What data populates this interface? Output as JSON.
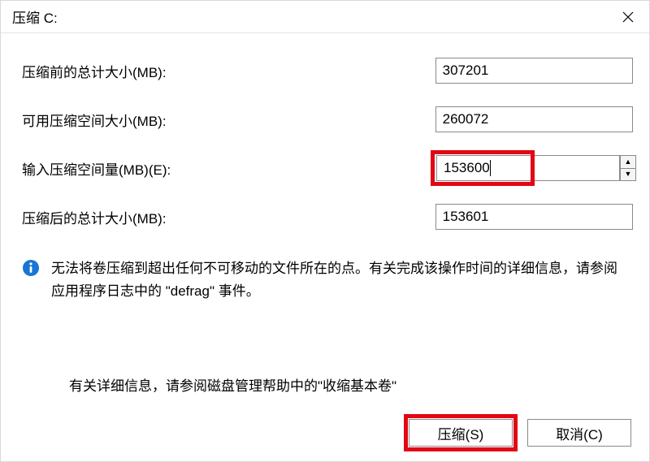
{
  "window": {
    "title": "压缩 C:"
  },
  "fields": {
    "totalBefore": {
      "label": "压缩前的总计大小(MB):",
      "value": "307201"
    },
    "available": {
      "label": "可用压缩空间大小(MB):",
      "value": "260072"
    },
    "shrinkAmt": {
      "label": "输入压缩空间量(MB)(E):",
      "value": "153600"
    },
    "totalAfter": {
      "label": "压缩后的总计大小(MB):",
      "value": "153601"
    }
  },
  "info": {
    "text": "无法将卷压缩到超出任何不可移动的文件所在的点。有关完成该操作时间的详细信息，请参阅应用程序日志中的 \"defrag\" 事件。"
  },
  "help": {
    "text": "有关详细信息，请参阅磁盘管理帮助中的\"收缩基本卷\""
  },
  "buttons": {
    "shrink": "压缩(S)",
    "cancel": "取消(C)"
  }
}
